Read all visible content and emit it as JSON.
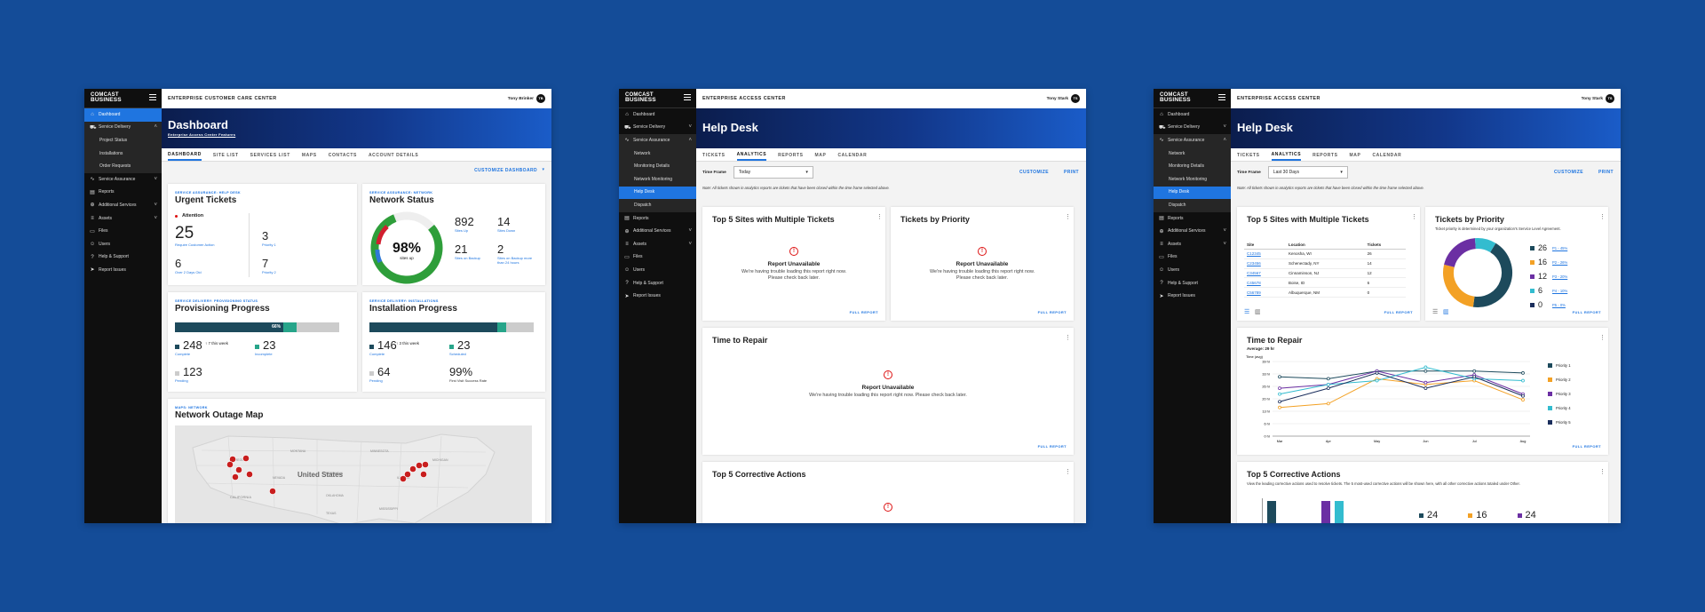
{
  "brand": {
    "line1": "COMCAST",
    "line2": "BUSINESS"
  },
  "screens": [
    {
      "app_title": "ENTERPRISE CUSTOMER CARE CENTER",
      "user_name": "Tony Brinker",
      "user_initials": "TB",
      "nav": [
        {
          "label": "Dashboard",
          "icon": "home-icon"
        },
        {
          "label": "Service Delivery",
          "icon": "truck-icon"
        },
        {
          "label": "Project Status"
        },
        {
          "label": "Installations"
        },
        {
          "label": "Order Requests"
        },
        {
          "label": "Service Assurance",
          "icon": "pulse-icon"
        },
        {
          "label": "Reports",
          "icon": "report-icon"
        },
        {
          "label": "Additional Services",
          "icon": "plus-circle-icon"
        },
        {
          "label": "Assets",
          "icon": "list-icon"
        },
        {
          "label": "Files",
          "icon": "folder-icon"
        },
        {
          "label": "Users",
          "icon": "users-icon"
        },
        {
          "label": "Help & Support",
          "icon": "help-icon"
        },
        {
          "label": "Report Issues",
          "icon": "send-icon"
        }
      ],
      "page_title": "Dashboard",
      "page_subtitle": "Enterprise Access Center Features",
      "tabs": [
        "DASHBOARD",
        "SITE LIST",
        "SERVICES LIST",
        "MAPS",
        "CONTACTS",
        "ACCOUNT DETAILS"
      ],
      "customize_label": "CUSTOMIZE DASHBOARD",
      "urgent": {
        "eyebrow": "SERVICE ASSURANCE: HELP DESK",
        "title": "Urgent Tickets",
        "attention": "Attention",
        "rc_value": "25",
        "rc_label": "Require Customer Action",
        "old_value": "6",
        "old_label": "Over 2 Days Old",
        "p1_value": "3",
        "p1_label": "Priority 1",
        "p2_value": "7",
        "p2_label": "Priority 2"
      },
      "network": {
        "eyebrow": "SERVICE ASSURANCE: NETWORK",
        "title": "Network Status",
        "pct": "98%",
        "pct_label": "sites up",
        "up_pct": 0.8,
        "sites_up": "892",
        "sites_up_label": "Sites Up",
        "sites_down": "14",
        "sites_down_label": "Sites Down",
        "backup": "21",
        "backup_label": "Sites on Backup",
        "backup24": "2",
        "backup24_label": "Sites on Backup more than 24 hours"
      },
      "provisioning": {
        "eyebrow": "SERVICE DELIVERY: PROVISIONING STATUS",
        "title": "Provisioning Progress",
        "bar_pct": "66%",
        "bar_dark": 0.66,
        "bar_teal": 0.08,
        "complete": "248",
        "complete_label": "Complete",
        "week": "7 this week",
        "incomplete": "23",
        "incomplete_label": "Incomplete",
        "pending": "123",
        "pending_label": "Pending"
      },
      "installation": {
        "eyebrow": "SERVICE DELIVERY: INSTALLATIONS",
        "title": "Installation Progress",
        "bar_dark": 0.78,
        "bar_teal": 0.05,
        "complete": "146",
        "complete_label": "Complete",
        "week": "3 this week",
        "scheduled": "23",
        "scheduled_label": "Scheduled",
        "pending": "64",
        "pending_label": "Pending",
        "success": "99%",
        "success_label": "First Visit Success Rate"
      },
      "map": {
        "eyebrow": "MAPS: NETWORK",
        "title": "Network Outage Map",
        "country_label": "United States",
        "state_label": "CALIFORNIA"
      }
    },
    {
      "app_title": "ENTERPRISE ACCESS CENTER",
      "user_name": "Tony Stark",
      "user_initials": "TS",
      "nav": [
        {
          "label": "Dashboard",
          "icon": "home-icon"
        },
        {
          "label": "Service Delivery",
          "icon": "truck-icon"
        },
        {
          "label": "Service Assurance",
          "icon": "pulse-icon"
        },
        {
          "label": "Network"
        },
        {
          "label": "Monitoring Details"
        },
        {
          "label": "Network Monitoring"
        },
        {
          "label": "Help Desk"
        },
        {
          "label": "Dispatch"
        },
        {
          "label": "Reports",
          "icon": "report-icon"
        },
        {
          "label": "Additional Services",
          "icon": "plus-circle-icon"
        },
        {
          "label": "Assets",
          "icon": "list-icon"
        },
        {
          "label": "Files",
          "icon": "folder-icon"
        },
        {
          "label": "Users",
          "icon": "users-icon"
        },
        {
          "label": "Help & Support",
          "icon": "help-icon"
        },
        {
          "label": "Report Issues",
          "icon": "send-icon"
        }
      ],
      "page_title": "Help Desk",
      "tabs": [
        "TICKETS",
        "ANALYTICS",
        "REPORTS",
        "MAP",
        "CALENDAR"
      ],
      "filter_label": "Time Frame",
      "filter_value": "Today",
      "customize": "CUSTOMIZE",
      "print": "PRINT",
      "note": "Note: All tickets shown in analytics reports are tickets that have been closed within the time frame selected above.",
      "cards": {
        "top5": "Top 5 Sites with Multiple Tickets",
        "priority": "Tickets by Priority",
        "repair": "Time to Repair",
        "corrective": "Top 5 Corrective Actions"
      },
      "unavailable_title": "Report Unavailable",
      "unavailable_msg": "We're having trouble loading this report right now.",
      "unavailable_msg2": "Please check back later.",
      "unavailable_msg_wide": "We're having trouble loading this report right now. Please check back later.",
      "full_report": "FULL REPORT"
    },
    {
      "app_title": "ENTERPRISE ACCESS CENTER",
      "user_name": "Tony Stark",
      "user_initials": "TS",
      "nav": [
        {
          "label": "Dashboard",
          "icon": "home-icon"
        },
        {
          "label": "Service Delivery",
          "icon": "truck-icon"
        },
        {
          "label": "Service Assurance",
          "icon": "pulse-icon"
        },
        {
          "label": "Network"
        },
        {
          "label": "Monitoring Details"
        },
        {
          "label": "Network Monitoring"
        },
        {
          "label": "Help Desk"
        },
        {
          "label": "Dispatch"
        },
        {
          "label": "Reports",
          "icon": "report-icon"
        },
        {
          "label": "Additional Services",
          "icon": "plus-circle-icon"
        },
        {
          "label": "Assets",
          "icon": "list-icon"
        },
        {
          "label": "Files",
          "icon": "folder-icon"
        },
        {
          "label": "Users",
          "icon": "users-icon"
        },
        {
          "label": "Help & Support",
          "icon": "help-icon"
        },
        {
          "label": "Report Issues",
          "icon": "send-icon"
        }
      ],
      "page_title": "Help Desk",
      "tabs": [
        "TICKETS",
        "ANALYTICS",
        "REPORTS",
        "MAP",
        "CALENDAR"
      ],
      "filter_label": "Time Frame",
      "filter_value": "Last 30 Days",
      "customize": "CUSTOMIZE",
      "print": "PRINT",
      "note": "Note: All tickets shown in analytics reports are tickets that have been closed within the time frame selected above.",
      "top5": {
        "title": "Top 5 Sites with Multiple Tickets",
        "headers": [
          "Site",
          "Location",
          "Tickets"
        ],
        "rows": [
          [
            "C12345",
            "Kenosha, WI",
            "26"
          ],
          [
            "C23456",
            "Schenectady, NY",
            "14"
          ],
          [
            "C34567",
            "Cinnaminson, NJ",
            "12"
          ],
          [
            "C45678",
            "Boise, ID",
            "6"
          ],
          [
            "C56789",
            "Albuquerque, NM",
            "0"
          ]
        ]
      },
      "priority": {
        "title": "Tickets by Priority",
        "subtitle": "Ticket priority is determined by your organization's Service Level Agreement."
      },
      "repair": {
        "title": "Time to Repair",
        "average": "Average: 29 hr"
      },
      "corrective": {
        "title": "Top 5 Corrective Actions",
        "subtitle": "View the leading corrective actions used to resolve tickets. The 5 most-used corrective actions will be shown here, with all other corrective actions totaled under Other.",
        "counts": [
          "24",
          "16",
          "24"
        ]
      },
      "full_report": "FULL REPORT"
    }
  ],
  "chart_data": [
    {
      "type": "pie",
      "title": "Tickets by Priority",
      "categories": [
        "P1",
        "P2",
        "P3",
        "P4",
        "P5"
      ],
      "values": [
        26,
        16,
        12,
        6,
        0
      ],
      "percent_labels": [
        "P1 - 45%",
        "P2 - 26%",
        "P3 - 20%",
        "P4 - 10%",
        "P5 - 0%"
      ],
      "colors": [
        "#1d4a5c",
        "#f3a125",
        "#6b2fa3",
        "#33bccf",
        "#1a2e5c"
      ]
    },
    {
      "type": "line",
      "title": "Time to Repair",
      "ylabel": "Time (avg)",
      "x": [
        "Mar",
        "Apr",
        "May",
        "Jun",
        "Jul",
        "Aug"
      ],
      "y_ticks": [
        "39 hr",
        "33 hr",
        "26 hr",
        "20 hr",
        "13 hr",
        "6 hr",
        "0 hr"
      ],
      "ylim": [
        0,
        39
      ],
      "series": [
        {
          "name": "Priority 1",
          "color": "#1d4a5c",
          "values": [
            31,
            30,
            34,
            34,
            34,
            33
          ]
        },
        {
          "name": "Priority 2",
          "color": "#f3a125",
          "values": [
            15,
            17,
            30,
            27,
            29,
            19
          ]
        },
        {
          "name": "Priority 3",
          "color": "#6b2fa3",
          "values": [
            25,
            27,
            34,
            28,
            32,
            22
          ]
        },
        {
          "name": "Priority 4",
          "color": "#33bccf",
          "values": [
            22,
            27,
            29,
            36,
            30,
            29
          ]
        },
        {
          "name": "Priority 5",
          "color": "#1a2e5c",
          "values": [
            18,
            25,
            33,
            25,
            31,
            21
          ]
        }
      ]
    }
  ]
}
